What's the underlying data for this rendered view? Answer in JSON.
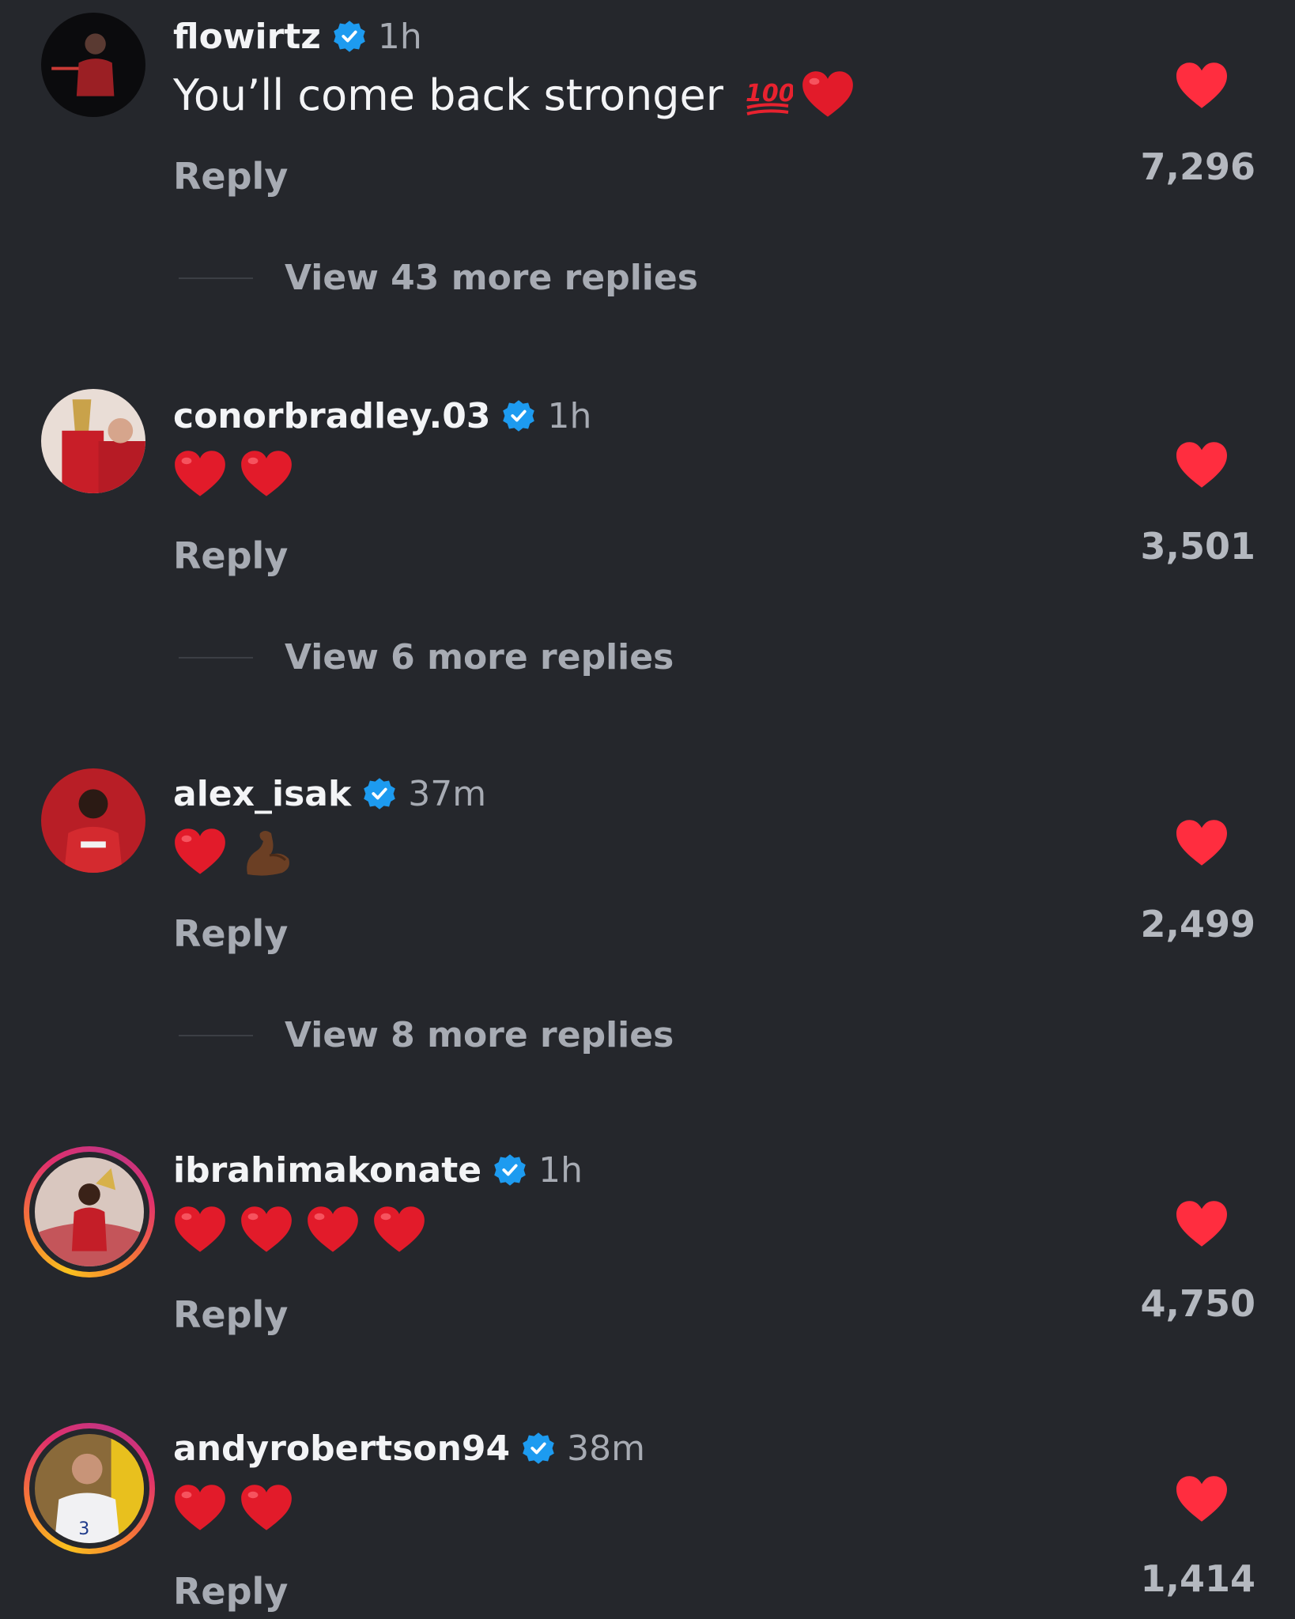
{
  "comments": [
    {
      "username": "flowirtz",
      "time": "1h",
      "text": "You’ll come back stronger",
      "emojis": [
        "hundred-points",
        "heart"
      ],
      "reply": "Reply",
      "likes": "7,296",
      "more_replies": "View 43 more replies",
      "avatar_ring": false
    },
    {
      "username": "conorbradley.03",
      "time": "1h",
      "text": "",
      "emojis": [
        "heart",
        "heart"
      ],
      "reply": "Reply",
      "likes": "3,501",
      "more_replies": "View 6 more replies",
      "avatar_ring": false
    },
    {
      "username": "alex_isak",
      "time": "37m",
      "text": "",
      "emojis": [
        "heart",
        "flexed-biceps"
      ],
      "reply": "Reply",
      "likes": "2,499",
      "more_replies": "View 8 more replies",
      "avatar_ring": false
    },
    {
      "username": "ibrahimakonate",
      "time": "1h",
      "text": "",
      "emojis": [
        "heart",
        "heart",
        "heart",
        "heart"
      ],
      "reply": "Reply",
      "likes": "4,750",
      "more_replies": "",
      "avatar_ring": true
    },
    {
      "username": "andyrobertson94",
      "time": "38m",
      "text": "",
      "emojis": [
        "heart",
        "heart"
      ],
      "reply": "Reply",
      "likes": "1,414",
      "more_replies": "",
      "avatar_ring": true
    }
  ],
  "colors": {
    "background": "#25272c",
    "like_heart": "#ff2d3f",
    "verified": "#1d9bf0",
    "text_muted": "#a7abb3"
  }
}
